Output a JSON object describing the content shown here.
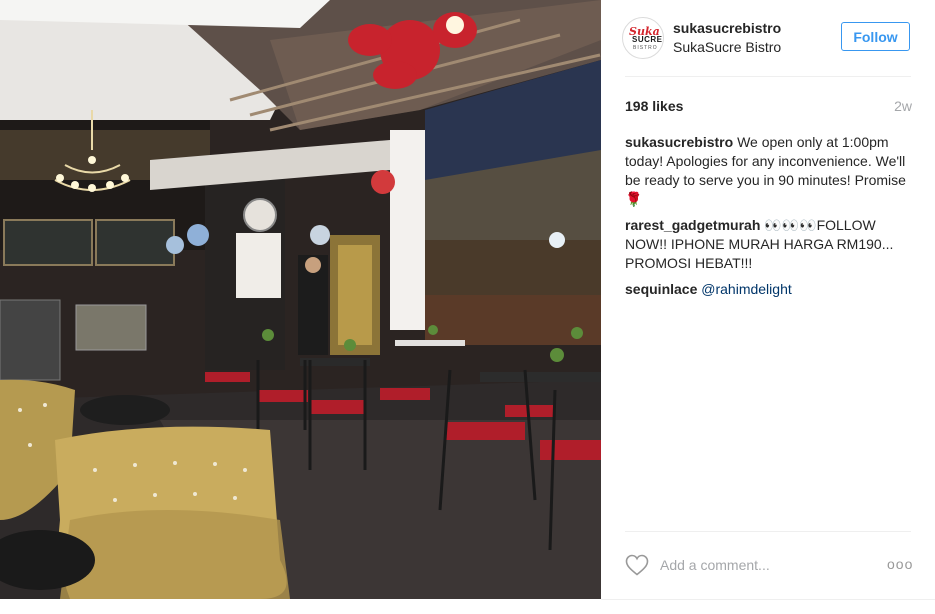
{
  "photo": {
    "alt": ""
  },
  "header": {
    "username": "sukasucrebistro",
    "fullname": "SukaSucre Bistro",
    "follow_label": "Follow",
    "avatar": {
      "line1": "Suka",
      "line2": "SUCRE",
      "line3": "BISTRO"
    }
  },
  "stats": {
    "likes": "198 likes",
    "time": "2w"
  },
  "comments": [
    {
      "user": "sukasucrebistro",
      "text": "We open only at 1:00pm today! Apologies for any inconvenience. We'll be ready to serve you in 90 minutes! Promise 🌹"
    },
    {
      "user": "rarest_gadgetmurah",
      "text": "👀👀👀FOLLOW NOW!! IPHONE MURAH HARGA RM190... PROMOSI HEBAT!!!"
    },
    {
      "user": "sequinlace",
      "mention": "@rahimdelight"
    }
  ],
  "add_comment": {
    "placeholder": "Add a comment...",
    "more_label": "ooo"
  },
  "colors": {
    "accent": "#3897f0",
    "mention": "#003569",
    "muted": "#a5a7aa"
  },
  "icons": {
    "like": "heart-outline-icon",
    "more": "more-options-icon"
  }
}
